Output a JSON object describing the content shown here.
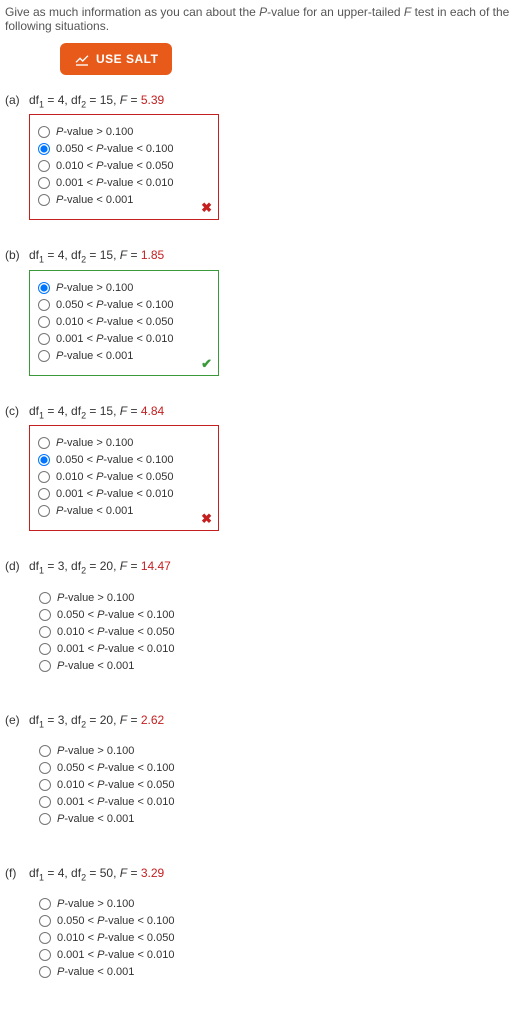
{
  "instructions": "Give as much information as you can about the ",
  "instructions_mid": "-value for an upper-tailed ",
  "instructions_end": " test in each of the following situations.",
  "salt_label": "USE SALT",
  "options": [
    "P-value > 0.100",
    "0.050 < P-value < 0.100",
    "0.010 < P-value < 0.050",
    "0.001 < P-value < 0.010",
    "P-value < 0.001"
  ],
  "parts": {
    "a": {
      "label": "(a)",
      "df1": "4",
      "df2": "15",
      "F": "5.39",
      "selected": 1,
      "border": "red",
      "icon": "x"
    },
    "b": {
      "label": "(b)",
      "df1": "4",
      "df2": "15",
      "F": "1.85",
      "selected": 0,
      "border": "green",
      "icon": "check"
    },
    "c": {
      "label": "(c)",
      "df1": "4",
      "df2": "15",
      "F": "4.84",
      "selected": 1,
      "border": "red",
      "icon": "x"
    },
    "d": {
      "label": "(d)",
      "df1": "3",
      "df2": "20",
      "F": "14.47",
      "selected": -1,
      "border": "none",
      "icon": ""
    },
    "e": {
      "label": "(e)",
      "df1": "3",
      "df2": "20",
      "F": "2.62",
      "selected": -1,
      "border": "none",
      "icon": ""
    },
    "f": {
      "label": "(f)",
      "df1": "4",
      "df2": "50",
      "F": "3.29",
      "selected": -1,
      "border": "none",
      "icon": ""
    }
  }
}
